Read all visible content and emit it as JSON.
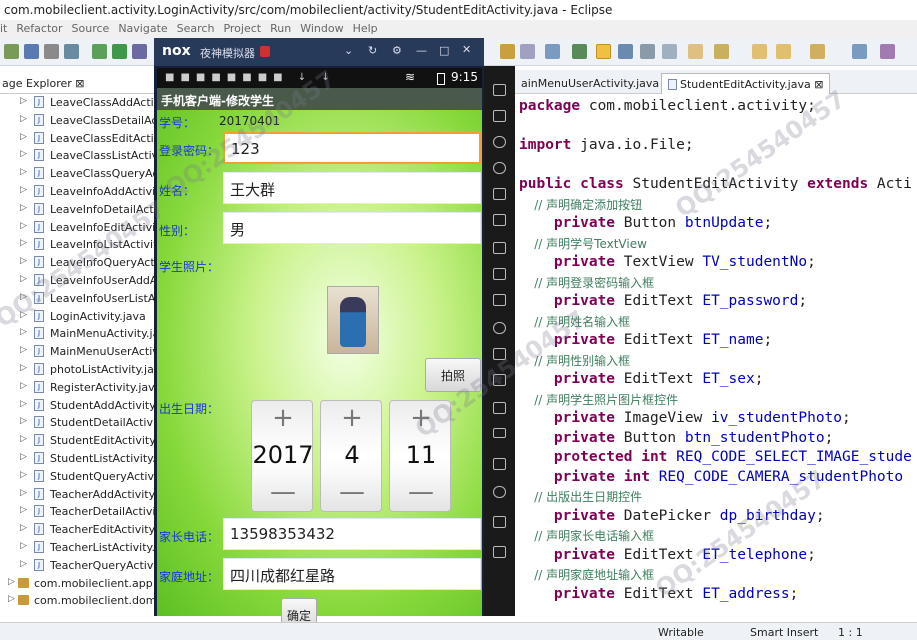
{
  "window": {
    "title": "com.mobileclient.activity.LoginActivity/src/com/mobileclient/activity/StudentEditActivity.java - Eclipse"
  },
  "menu": [
    "it",
    "Refactor",
    "Source",
    "Navigate",
    "Search",
    "Project",
    "Run",
    "Window",
    "Help"
  ],
  "package_explorer": {
    "title": "age Explorer",
    "items": [
      "LeaveClassAddActivi",
      "LeaveClassDetailActi",
      "LeaveClassEditActivi",
      "LeaveClassListActivi",
      "LeaveClassQueryActi",
      "LeaveInfoAddActivity",
      "LeaveInfoDetailActiv",
      "LeaveInfoEditActivity",
      "LeaveInfoListActivity",
      "LeaveInfoQueryActiv",
      "LeaveInfoUserAddAc",
      "LeaveInfoUserListAct",
      "LoginActivity.java",
      "MainMenuActivity.jav",
      "MainMenuUserActivi",
      "photoListActivity.java",
      "RegisterActivity.java",
      "StudentAddActivity.ja",
      "StudentDetailActivity",
      "StudentEditActivity.ja",
      "StudentListActivity.ja",
      "StudentQueryActivity",
      "TeacherAddActivity.ja",
      "TeacherDetailActivity",
      "TeacherEditActivity.ja",
      "TeacherListActivity.ja",
      "TeacherQueryActivity"
    ],
    "packages": [
      "com.mobileclient.app",
      "com.mobileclient.domai"
    ]
  },
  "editor": {
    "tabs": [
      "ainMenuUserActivity.java",
      "StudentEditActivity.java"
    ],
    "lines": [
      [
        {
          "t": "package",
          "c": "kw"
        },
        {
          "t": " com.mobileclient.activity;"
        }
      ],
      [],
      [
        {
          "t": "import",
          "c": "kw"
        },
        {
          "t": " java.io.File;"
        }
      ],
      [],
      [
        {
          "t": "public class",
          "c": "kw"
        },
        {
          "t": " StudentEditActivity "
        },
        {
          "t": "extends",
          "c": "kw"
        },
        {
          "t": " Acti"
        }
      ],
      [
        {
          "t": "    // 声明确定添加按钮",
          "c": "cm"
        }
      ],
      [
        {
          "t": "    "
        },
        {
          "t": "private",
          "c": "kw"
        },
        {
          "t": " Button "
        },
        {
          "t": "btnUpdate",
          "c": "fd"
        },
        {
          "t": ";"
        }
      ],
      [
        {
          "t": "    // 声明学号TextView",
          "c": "cm"
        }
      ],
      [
        {
          "t": "    "
        },
        {
          "t": "private",
          "c": "kw"
        },
        {
          "t": " TextView "
        },
        {
          "t": "TV_studentNo",
          "c": "fd"
        },
        {
          "t": ";"
        }
      ],
      [
        {
          "t": "    // 声明登录密码输入框",
          "c": "cm"
        }
      ],
      [
        {
          "t": "    "
        },
        {
          "t": "private",
          "c": "kw"
        },
        {
          "t": " EditText "
        },
        {
          "t": "ET_password",
          "c": "fd"
        },
        {
          "t": ";"
        }
      ],
      [
        {
          "t": "    // 声明姓名输入框",
          "c": "cm"
        }
      ],
      [
        {
          "t": "    "
        },
        {
          "t": "private",
          "c": "kw"
        },
        {
          "t": " EditText "
        },
        {
          "t": "ET_name",
          "c": "fd"
        },
        {
          "t": ";"
        }
      ],
      [
        {
          "t": "    // 声明性别输入框",
          "c": "cm"
        }
      ],
      [
        {
          "t": "    "
        },
        {
          "t": "private",
          "c": "kw"
        },
        {
          "t": " EditText "
        },
        {
          "t": "ET_sex",
          "c": "fd"
        },
        {
          "t": ";"
        }
      ],
      [
        {
          "t": "    // 声明学生照片图片框控件",
          "c": "cm"
        }
      ],
      [
        {
          "t": "    "
        },
        {
          "t": "private",
          "c": "kw"
        },
        {
          "t": " ImageView "
        },
        {
          "t": "iv_studentPhoto",
          "c": "fd"
        },
        {
          "t": ";"
        }
      ],
      [
        {
          "t": "    "
        },
        {
          "t": "private",
          "c": "kw"
        },
        {
          "t": " Button "
        },
        {
          "t": "btn_studentPhoto",
          "c": "fd"
        },
        {
          "t": ";"
        }
      ],
      [
        {
          "t": "    "
        },
        {
          "t": "protected int",
          "c": "kw"
        },
        {
          "t": " "
        },
        {
          "t": "REQ_CODE_SELECT_IMAGE_stude",
          "c": "fd"
        }
      ],
      [
        {
          "t": "    "
        },
        {
          "t": "private int",
          "c": "kw"
        },
        {
          "t": " "
        },
        {
          "t": "REQ_CODE_CAMERA_studentPhoto",
          "c": "fd"
        }
      ],
      [
        {
          "t": "    // 出版出生日期控件",
          "c": "cm"
        }
      ],
      [
        {
          "t": "    "
        },
        {
          "t": "private",
          "c": "kw"
        },
        {
          "t": " DatePicker "
        },
        {
          "t": "dp_birthday",
          "c": "fd"
        },
        {
          "t": ";"
        }
      ],
      [
        {
          "t": "    // 声明家长电话输入框",
          "c": "cm"
        }
      ],
      [
        {
          "t": "    "
        },
        {
          "t": "private",
          "c": "kw"
        },
        {
          "t": " EditText "
        },
        {
          "t": "ET_telephone",
          "c": "fd"
        },
        {
          "t": ";"
        }
      ],
      [
        {
          "t": "    // 声明家庭地址输入框",
          "c": "cm"
        }
      ],
      [
        {
          "t": "    "
        },
        {
          "t": "private",
          "c": "kw"
        },
        {
          "t": " EditText "
        },
        {
          "t": "ET_address",
          "c": "fd"
        },
        {
          "t": ";"
        }
      ]
    ]
  },
  "status": {
    "writable": "Writable",
    "insert": "Smart Insert",
    "position": "1 : 1"
  },
  "emulator": {
    "brand": "nox",
    "name": "夜神模拟器",
    "time": "9:15",
    "app_title": "手机客户端-修改学生",
    "form": {
      "student_no_label": "学号：",
      "student_no": "20170401",
      "password_label": "登录密码：",
      "password": "123",
      "name_label": "姓名：",
      "name": "王大群",
      "sex_label": "性别：",
      "sex": "男",
      "photo_label": "学生照片：",
      "photo_button": "拍照",
      "birthday_label": "出生日期：",
      "year": "2017",
      "month": "4",
      "day": "11",
      "phone_label": "家长电话：",
      "phone": "13598353432",
      "address_label": "家庭地址：",
      "address": "四川成都红星路",
      "confirm_button": "确定"
    }
  },
  "watermark": "QQ:254540457"
}
